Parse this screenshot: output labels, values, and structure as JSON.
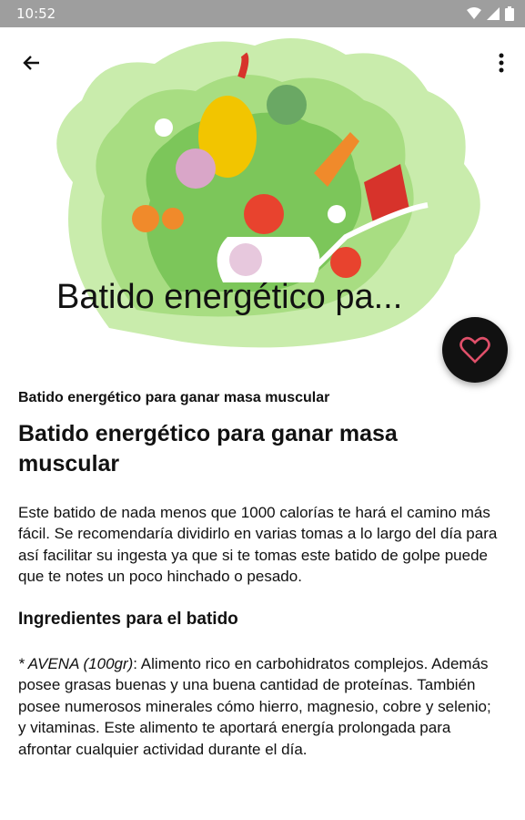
{
  "status_bar": {
    "time": "10:52"
  },
  "toolbar": {
    "back_icon": "arrow-left-icon",
    "menu_icon": "more-vert-icon"
  },
  "hero": {
    "title": "Batido energético pa..."
  },
  "fab": {
    "icon": "heart-outline-icon",
    "icon_color": "#e0506a"
  },
  "article": {
    "subtitle": "Batido energético para ganar masa muscular",
    "heading": "Batido energético para ganar masa muscular",
    "intro": "Este batido de nada menos que 1000 calorías te hará el camino más fácil. Se recomendaría dividirlo en varias tomas a lo largo del día para así facilitar su ingesta ya que si te tomas este batido de golpe puede que te notes un poco hinchado o pesado.",
    "section_title": "Ingredientes para el batido",
    "ingredient_name": "* AVENA (100gr)",
    "ingredient_text": ": Alimento rico en carbohidratos complejos. Además posee grasas buenas y una buena cantidad de proteínas. También posee numerosos minerales cómo hierro, magnesio, cobre y selenio; y vitaminas. Este alimento te aportará energía prolongada para afrontar cualquier actividad durante el día."
  }
}
